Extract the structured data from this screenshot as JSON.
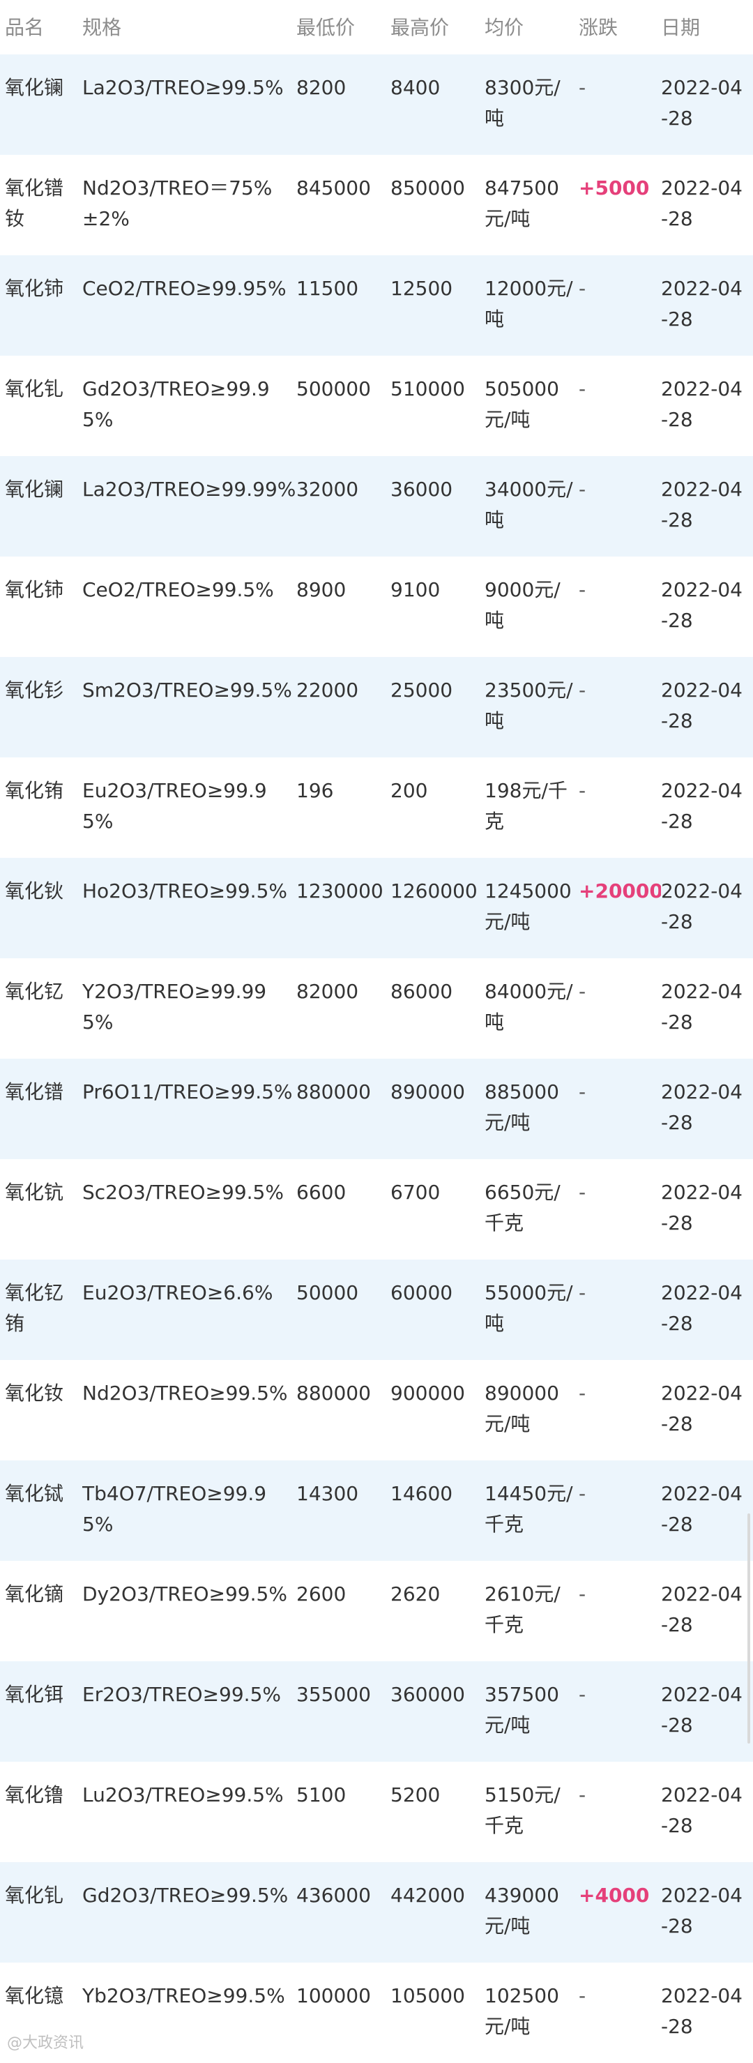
{
  "header": {
    "name": "品名",
    "spec": "规格",
    "low": "最低价",
    "high": "最高价",
    "avg": "均价",
    "change": "涨跌",
    "date": "日期"
  },
  "rows": [
    {
      "name": "氧化镧",
      "spec": "La2O3/TREO≥99.5%",
      "low": "8200",
      "high": "8400",
      "avg": "8300元/吨",
      "change": "-",
      "date": "2022-04-28",
      "up": false
    },
    {
      "name": "氧化镨钕",
      "spec": "Nd2O3/TREO＝75%±2%",
      "low": "845000",
      "high": "850000",
      "avg": "847500元/吨",
      "change": "+5000",
      "date": "2022-04-28",
      "up": true
    },
    {
      "name": "氧化铈",
      "spec": "CeO2/TREO≥99.95%",
      "low": "11500",
      "high": "12500",
      "avg": "12000元/吨",
      "change": "-",
      "date": "2022-04-28",
      "up": false
    },
    {
      "name": "氧化钆",
      "spec": "Gd2O3/TREO≥99.95%",
      "low": "500000",
      "high": "510000",
      "avg": "505000元/吨",
      "change": "-",
      "date": "2022-04-28",
      "up": false
    },
    {
      "name": "氧化镧",
      "spec": "La2O3/TREO≥99.99%",
      "low": "32000",
      "high": "36000",
      "avg": "34000元/吨",
      "change": "-",
      "date": "2022-04-28",
      "up": false
    },
    {
      "name": "氧化铈",
      "spec": "CeO2/TREO≥99.5%",
      "low": "8900",
      "high": "9100",
      "avg": "9000元/吨",
      "change": "-",
      "date": "2022-04-28",
      "up": false
    },
    {
      "name": "氧化钐",
      "spec": "Sm2O3/TREO≥99.5%",
      "low": "22000",
      "high": "25000",
      "avg": "23500元/吨",
      "change": "-",
      "date": "2022-04-28",
      "up": false
    },
    {
      "name": "氧化铕",
      "spec": "Eu2O3/TREO≥99.95%",
      "low": "196",
      "high": "200",
      "avg": "198元/千克",
      "change": "-",
      "date": "2022-04-28",
      "up": false
    },
    {
      "name": "氧化钬",
      "spec": "Ho2O3/TREO≥99.5%",
      "low": "1230000",
      "high": "1260000",
      "avg": "1245000元/吨",
      "change": "+20000",
      "date": "2022-04-28",
      "up": true
    },
    {
      "name": "氧化钇",
      "spec": "Y2O3/TREO≥99.995%",
      "low": "82000",
      "high": "86000",
      "avg": "84000元/吨",
      "change": "-",
      "date": "2022-04-28",
      "up": false
    },
    {
      "name": "氧化镨",
      "spec": "Pr6O11/TREO≥99.5%",
      "low": "880000",
      "high": "890000",
      "avg": "885000元/吨",
      "change": "-",
      "date": "2022-04-28",
      "up": false
    },
    {
      "name": "氧化钪",
      "spec": "Sc2O3/TREO≥99.5%",
      "low": "6600",
      "high": "6700",
      "avg": "6650元/千克",
      "change": "-",
      "date": "2022-04-28",
      "up": false
    },
    {
      "name": "氧化钇铕",
      "spec": "Eu2O3/TREO≥6.6%",
      "low": "50000",
      "high": "60000",
      "avg": "55000元/吨",
      "change": "-",
      "date": "2022-04-28",
      "up": false
    },
    {
      "name": "氧化钕",
      "spec": "Nd2O3/TREO≥99.5%",
      "low": "880000",
      "high": "900000",
      "avg": "890000元/吨",
      "change": "-",
      "date": "2022-04-28",
      "up": false
    },
    {
      "name": "氧化铽",
      "spec": "Tb4O7/TREO≥99.95%",
      "low": "14300",
      "high": "14600",
      "avg": "14450元/千克",
      "change": "-",
      "date": "2022-04-28",
      "up": false
    },
    {
      "name": "氧化镝",
      "spec": "Dy2O3/TREO≥99.5%",
      "low": "2600",
      "high": "2620",
      "avg": "2610元/千克",
      "change": "-",
      "date": "2022-04-28",
      "up": false
    },
    {
      "name": "氧化铒",
      "spec": "Er2O3/TREO≥99.5%",
      "low": "355000",
      "high": "360000",
      "avg": "357500元/吨",
      "change": "-",
      "date": "2022-04-28",
      "up": false
    },
    {
      "name": "氧化镥",
      "spec": "Lu2O3/TREO≥99.5%",
      "low": "5100",
      "high": "5200",
      "avg": "5150元/千克",
      "change": "-",
      "date": "2022-04-28",
      "up": false
    },
    {
      "name": "氧化钆",
      "spec": "Gd2O3/TREO≥99.5%",
      "low": "436000",
      "high": "442000",
      "avg": "439000元/吨",
      "change": "+4000",
      "date": "2022-04-28",
      "up": true
    },
    {
      "name": "氧化镱",
      "spec": "Yb2O3/TREO≥99.5%",
      "low": "100000",
      "high": "105000",
      "avg": "102500元/吨",
      "change": "-",
      "date": "2022-04-28",
      "up": false
    }
  ],
  "watermark": "@大政资讯",
  "colors": {
    "row_shade": "#ecf5fc",
    "change_up": "#e5407a",
    "header_text": "#8c8c8c"
  }
}
